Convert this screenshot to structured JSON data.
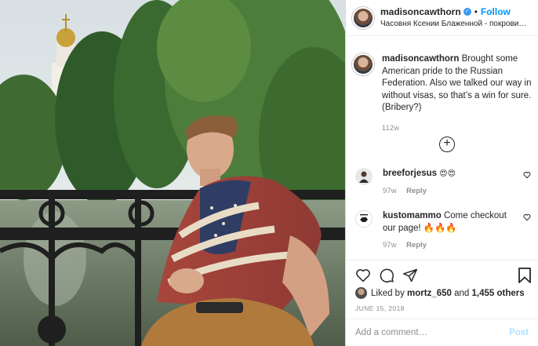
{
  "post": {
    "username": "madisoncawthorn",
    "verified_mark": "✓",
    "dot": "•",
    "follow_label": "Follow",
    "location": "Часовня Ксении Блаженной - покровите..."
  },
  "caption": {
    "username": "madisoncawthorn",
    "text": "Brought some American pride to the Russian Federation. Also we talked our way in without visas, so that’s a win for sure. (Bribery?)",
    "time": "112w"
  },
  "load_more_icon": "+",
  "comments": [
    {
      "username": "breeforjesus",
      "text": "😍😍",
      "time": "97w",
      "reply": "Reply"
    },
    {
      "username": "kustomammo",
      "text": "Come checkout our page! 🔥🔥🔥",
      "time": "97w",
      "reply": "Reply"
    }
  ],
  "likes": {
    "prefix": "Liked by",
    "user": "mortz_650",
    "middle": "and",
    "others": "1,455 others"
  },
  "date": "JUNE 15, 2018",
  "add_comment": {
    "placeholder": "Add a comment…",
    "post_label": "Post"
  },
  "icons": {
    "like": "heart-icon",
    "comment": "comment-icon",
    "share": "share-icon",
    "save": "bookmark-icon",
    "comment_like": "heart-icon"
  },
  "colors": {
    "follow": "#0095f6",
    "verified": "#3897f0",
    "post_disabled": "#b2dffc",
    "muted": "#8e8e8e"
  }
}
